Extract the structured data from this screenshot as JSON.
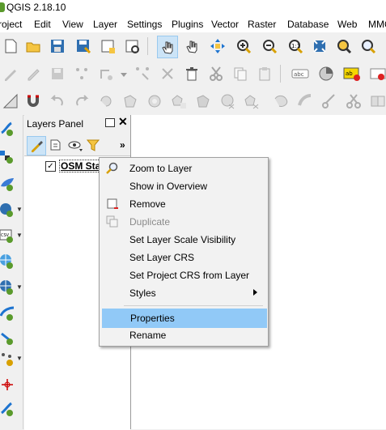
{
  "window": {
    "title": "QGIS 2.18.10"
  },
  "menubar": {
    "items": [
      "roject",
      "Edit",
      "View",
      "Layer",
      "Settings",
      "Plugins",
      "Vector",
      "Raster",
      "Database",
      "Web",
      "MMQ"
    ]
  },
  "layers_panel": {
    "title": "Layers Panel",
    "more": "»",
    "close": "✕",
    "layer": {
      "name": "OSM Sta",
      "checked": "✓"
    }
  },
  "context_menu": {
    "zoom_to_layer": "Zoom to Layer",
    "show_in_overview": "Show in Overview",
    "remove": "Remove",
    "duplicate": "Duplicate",
    "set_layer_scale_visibility": "Set Layer Scale Visibility",
    "set_layer_crs": "Set Layer CRS",
    "set_project_crs_from_layer": "Set Project CRS from Layer",
    "styles": "Styles",
    "properties": "Properties",
    "rename": "Rename"
  },
  "colors": {
    "highlight": "#91c9f7",
    "active_tool": "#cce4f7",
    "qgis_green": "#5a9a2c",
    "disabled_text": "#8a8a8a"
  }
}
